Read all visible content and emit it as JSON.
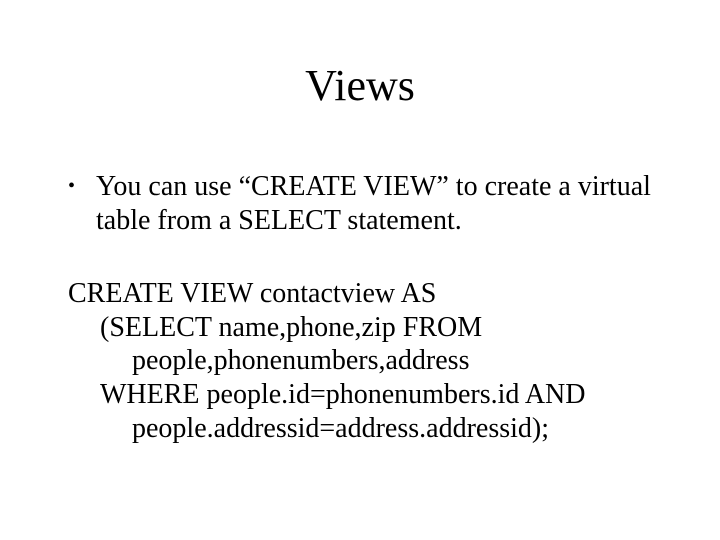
{
  "title": "Views",
  "bullet": {
    "text": "You can use “CREATE VIEW” to create a virtual table from a SELECT statement."
  },
  "code": {
    "l1": "CREATE VIEW contactview AS",
    "l2": "(SELECT name,phone,zip FROM",
    "l3": "people,phonenumbers,address",
    "l4": "WHERE people.id=phonenumbers.id AND",
    "l5": "people.addressid=address.addressid);"
  }
}
